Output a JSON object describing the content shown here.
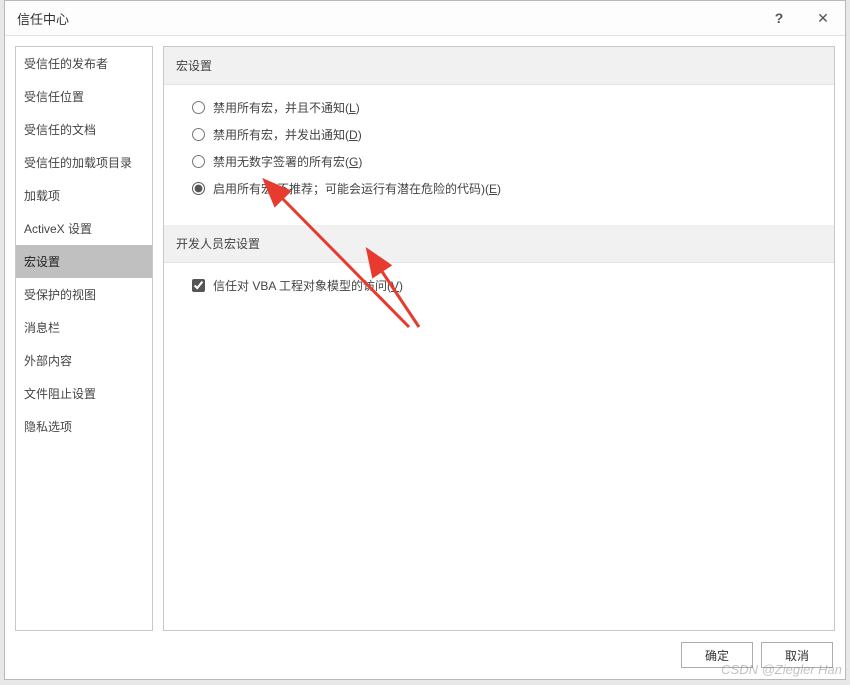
{
  "titlebar": {
    "title": "信任中心",
    "help": "?",
    "close": "✕"
  },
  "sidebar": {
    "items": [
      {
        "label": "受信任的发布者"
      },
      {
        "label": "受信任位置"
      },
      {
        "label": "受信任的文档"
      },
      {
        "label": "受信任的加载项目录"
      },
      {
        "label": "加载项"
      },
      {
        "label": "ActiveX 设置"
      },
      {
        "label": "宏设置"
      },
      {
        "label": "受保护的视图"
      },
      {
        "label": "消息栏"
      },
      {
        "label": "外部内容"
      },
      {
        "label": "文件阻止设置"
      },
      {
        "label": "隐私选项"
      }
    ],
    "selected_index": 6
  },
  "sections": {
    "macro": {
      "title": "宏设置",
      "options": [
        {
          "label": "禁用所有宏，并且不通知",
          "hotkey": "L"
        },
        {
          "label": "禁用所有宏，并发出通知",
          "hotkey": "D"
        },
        {
          "label": "禁用无数字签署的所有宏",
          "hotkey": "G"
        },
        {
          "label": "启用所有宏(不推荐；可能会运行有潜在危险的代码)",
          "hotkey": "E"
        }
      ],
      "selected_index": 3
    },
    "developer": {
      "title": "开发人员宏设置",
      "checkbox": {
        "label": "信任对 VBA 工程对象模型的访问",
        "hotkey": "V",
        "checked": true
      }
    }
  },
  "footer": {
    "ok": "确定",
    "cancel": "取消"
  },
  "watermark": "CSDN @Ziegler Han"
}
